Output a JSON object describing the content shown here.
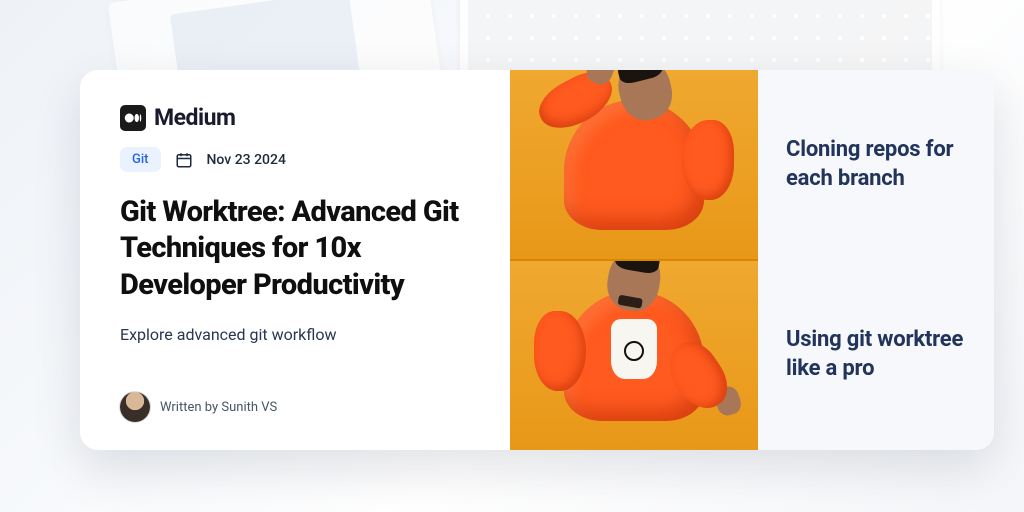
{
  "brand": {
    "name": "Medium"
  },
  "meta": {
    "tag": "Git",
    "date": "Nov 23 2024"
  },
  "article": {
    "title": "Git Worktree: Advanced Git Techniques for 10x Developer Productivity",
    "subtitle": "Explore advanced git workflow",
    "author_line": "Written by Sunith VS"
  },
  "meme": {
    "top_caption": "Cloning repos for each branch",
    "bottom_caption": "Using git worktree like a pro"
  }
}
